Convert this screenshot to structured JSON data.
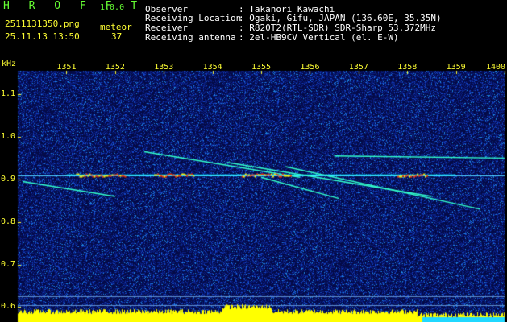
{
  "app": {
    "title": "H R O F F T",
    "version": "1.0.0",
    "filename": "2511131350.png",
    "datetime": "25.11.13 13:50",
    "meteor_label": "meteor",
    "meteor_count": "37"
  },
  "info": {
    "rows": [
      {
        "label": "Observer",
        "value": ": Takanori Kawachi"
      },
      {
        "label": "Receiving Location",
        "value": ": Ogaki, Gifu, JAPAN (136.60E, 35.35N)"
      },
      {
        "label": "Receiver",
        "value": ": R820T2(RTL-SDR) SDR-Sharp 53.372MHz"
      },
      {
        "label": "Receiving antenna",
        "value": ": 2el-HB9CV Vertical (el. E-W)"
      }
    ]
  },
  "colors": {
    "background": "#000000",
    "label_yellow": "#ffff33",
    "label_green": "#66ff33",
    "noise_floor_blue": "#0a1a6e",
    "signal_cyan": "#00ffff",
    "signal_red": "#ff3300",
    "baseline_yellow": "#ffff00"
  },
  "chart_data": {
    "type": "heatmap",
    "ylabel": "kHz",
    "x_ticks": [
      "1351",
      "1352",
      "1353",
      "1354",
      "1355",
      "1356",
      "1357",
      "1358",
      "1359",
      "1400"
    ],
    "y_ticks": [
      "1.1",
      "1.0",
      "0.9",
      "0.8",
      "0.7",
      "0.6"
    ],
    "y_tick_values": [
      1.1,
      1.0,
      0.9,
      0.8,
      0.7,
      0.6
    ],
    "ylim": [
      0.565,
      1.155
    ],
    "xlim": [
      1350,
      1400
    ],
    "carrier_khz": 0.91,
    "meteor_traces": [
      {
        "t0": 1351.0,
        "f0": 0.91,
        "t1": 1359.0,
        "f1": 0.91
      },
      {
        "t0": 1352.6,
        "f0": 0.965,
        "t1": 1355.8,
        "f1": 0.905
      },
      {
        "t0": 1354.3,
        "f0": 0.94,
        "t1": 1358.5,
        "f1": 0.86
      },
      {
        "t0": 1355.5,
        "f0": 0.93,
        "t1": 1359.5,
        "f1": 0.83
      },
      {
        "t0": 1355.0,
        "f0": 0.905,
        "t1": 1356.6,
        "f1": 0.855
      },
      {
        "t0": 1350.1,
        "f0": 0.895,
        "t1": 1352.0,
        "f1": 0.86
      },
      {
        "t0": 1356.5,
        "f0": 0.955,
        "t1": 1400.0,
        "f1": 0.95
      }
    ]
  }
}
